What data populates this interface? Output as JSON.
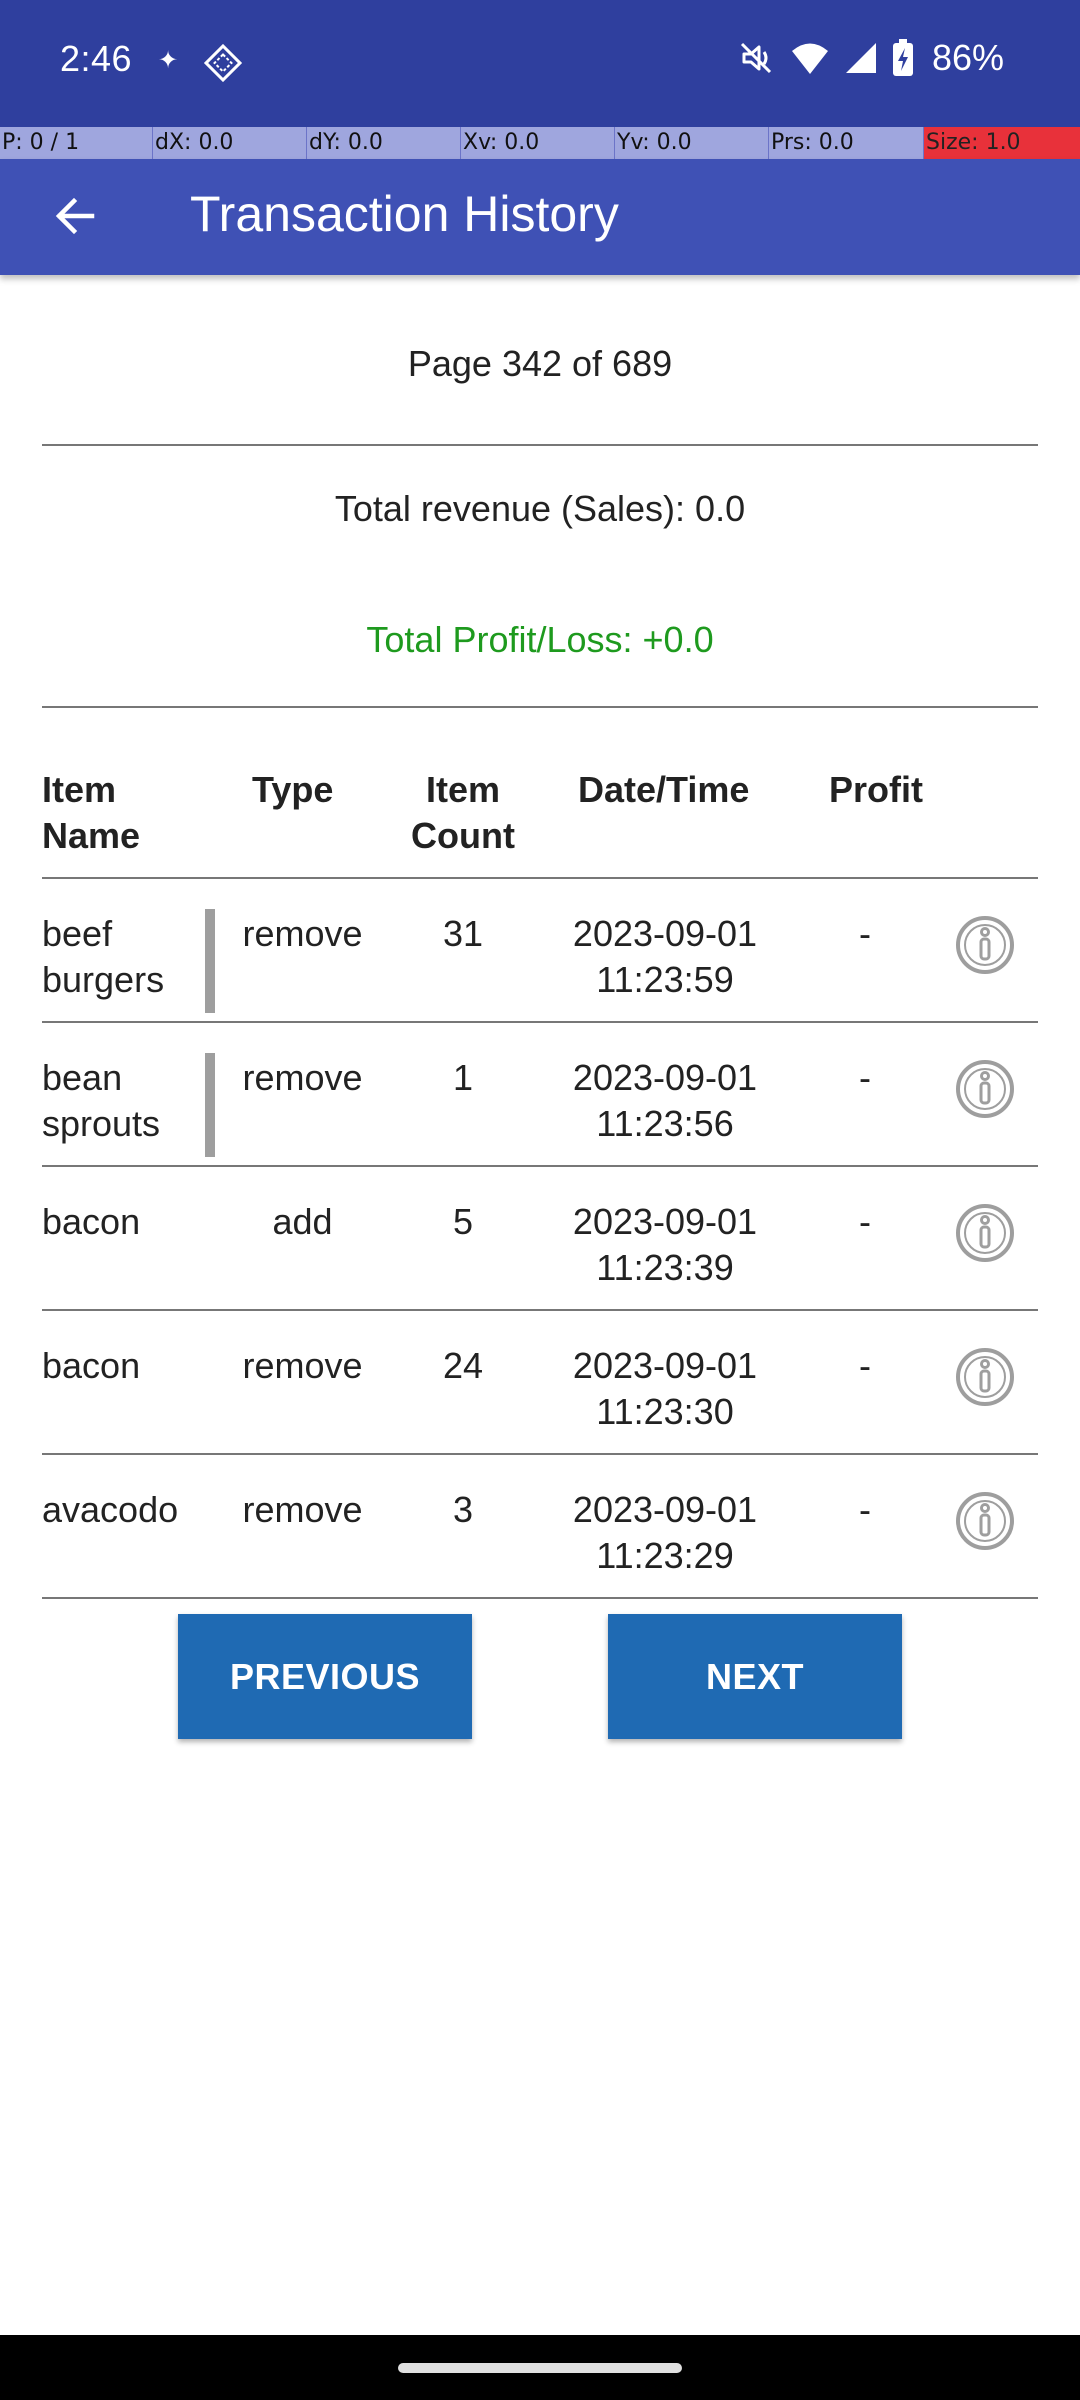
{
  "status_bar": {
    "time": "2:46",
    "battery": "86%",
    "icons": [
      "sparkle-icon",
      "app-diamond-icon",
      "mute-icon",
      "wifi-icon",
      "signal-icon",
      "battery-charging-icon"
    ]
  },
  "pointer_overlay": {
    "p": "P: 0 / 1",
    "dx": "dX: 0.0",
    "dy": "dY: 0.0",
    "xv": "Xv: 0.0",
    "yv": "Yv: 0.0",
    "prs": "Prs: 0.0",
    "size": "Size: 1.0"
  },
  "toolbar": {
    "title": "Transaction History",
    "back_icon": "arrow-back-icon"
  },
  "summary": {
    "page": "Page 342 of 689",
    "revenue": "Total revenue (Sales): 0.0",
    "profit_loss": "Total Profit/Loss: +0.0"
  },
  "table": {
    "headers": {
      "item_name": [
        "Item",
        "Name"
      ],
      "type": "Type",
      "item_count": [
        "Item",
        "Count"
      ],
      "datetime": "Date/Time",
      "profit": "Profit"
    },
    "rows": [
      {
        "name": [
          "beef",
          "burgers"
        ],
        "type": "remove",
        "count": "31",
        "date": "2023-09-01",
        "time": "11:23:59",
        "profit": "-",
        "marker": true
      },
      {
        "name": [
          "bean",
          "sprouts"
        ],
        "type": "remove",
        "count": "1",
        "date": "2023-09-01",
        "time": "11:23:56",
        "profit": "-",
        "marker": true
      },
      {
        "name": [
          "bacon",
          ""
        ],
        "type": "add",
        "count": "5",
        "date": "2023-09-01",
        "time": "11:23:39",
        "profit": "-",
        "marker": false
      },
      {
        "name": [
          "bacon",
          ""
        ],
        "type": "remove",
        "count": "24",
        "date": "2023-09-01",
        "time": "11:23:30",
        "profit": "-",
        "marker": false
      },
      {
        "name": [
          "avacodo",
          ""
        ],
        "type": "remove",
        "count": "3",
        "date": "2023-09-01",
        "time": "11:23:29",
        "profit": "-",
        "marker": false
      }
    ]
  },
  "buttons": {
    "previous": "PREVIOUS",
    "next": "NEXT"
  },
  "colors": {
    "status_bar": "#2f3f9e",
    "toolbar": "#3f51b5",
    "button": "#1f6ab3",
    "profit_text": "#1e9a1e"
  }
}
